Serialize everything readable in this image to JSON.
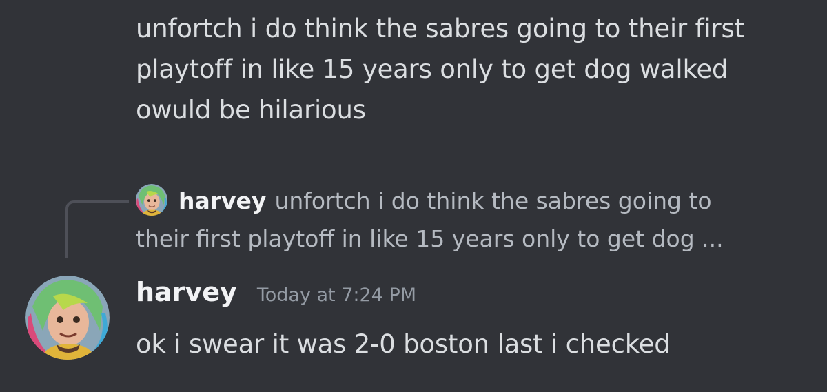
{
  "messages": [
    {
      "text": "unfortch i do think the sabres going to their first playtoff in like 15 years only to get dog walked owuld be hilarious"
    },
    {
      "reply": {
        "author": "harvey",
        "line1": "unfortch i do think the sabres going to",
        "line2": "their first playtoff in like 15 years only to get dog ..."
      },
      "author": "harvey",
      "timestamp": "Today at 7:24 PM",
      "text": "ok i swear it was 2-0 boston last i checked"
    }
  ],
  "colors": {
    "background": "#313338",
    "message_text": "#dbdee1",
    "author": "#f2f3f5",
    "muted": "#949ba4",
    "reply_spine": "#4e5058"
  },
  "icons": {
    "avatar": "avatar-illustration-colorful-hair"
  }
}
